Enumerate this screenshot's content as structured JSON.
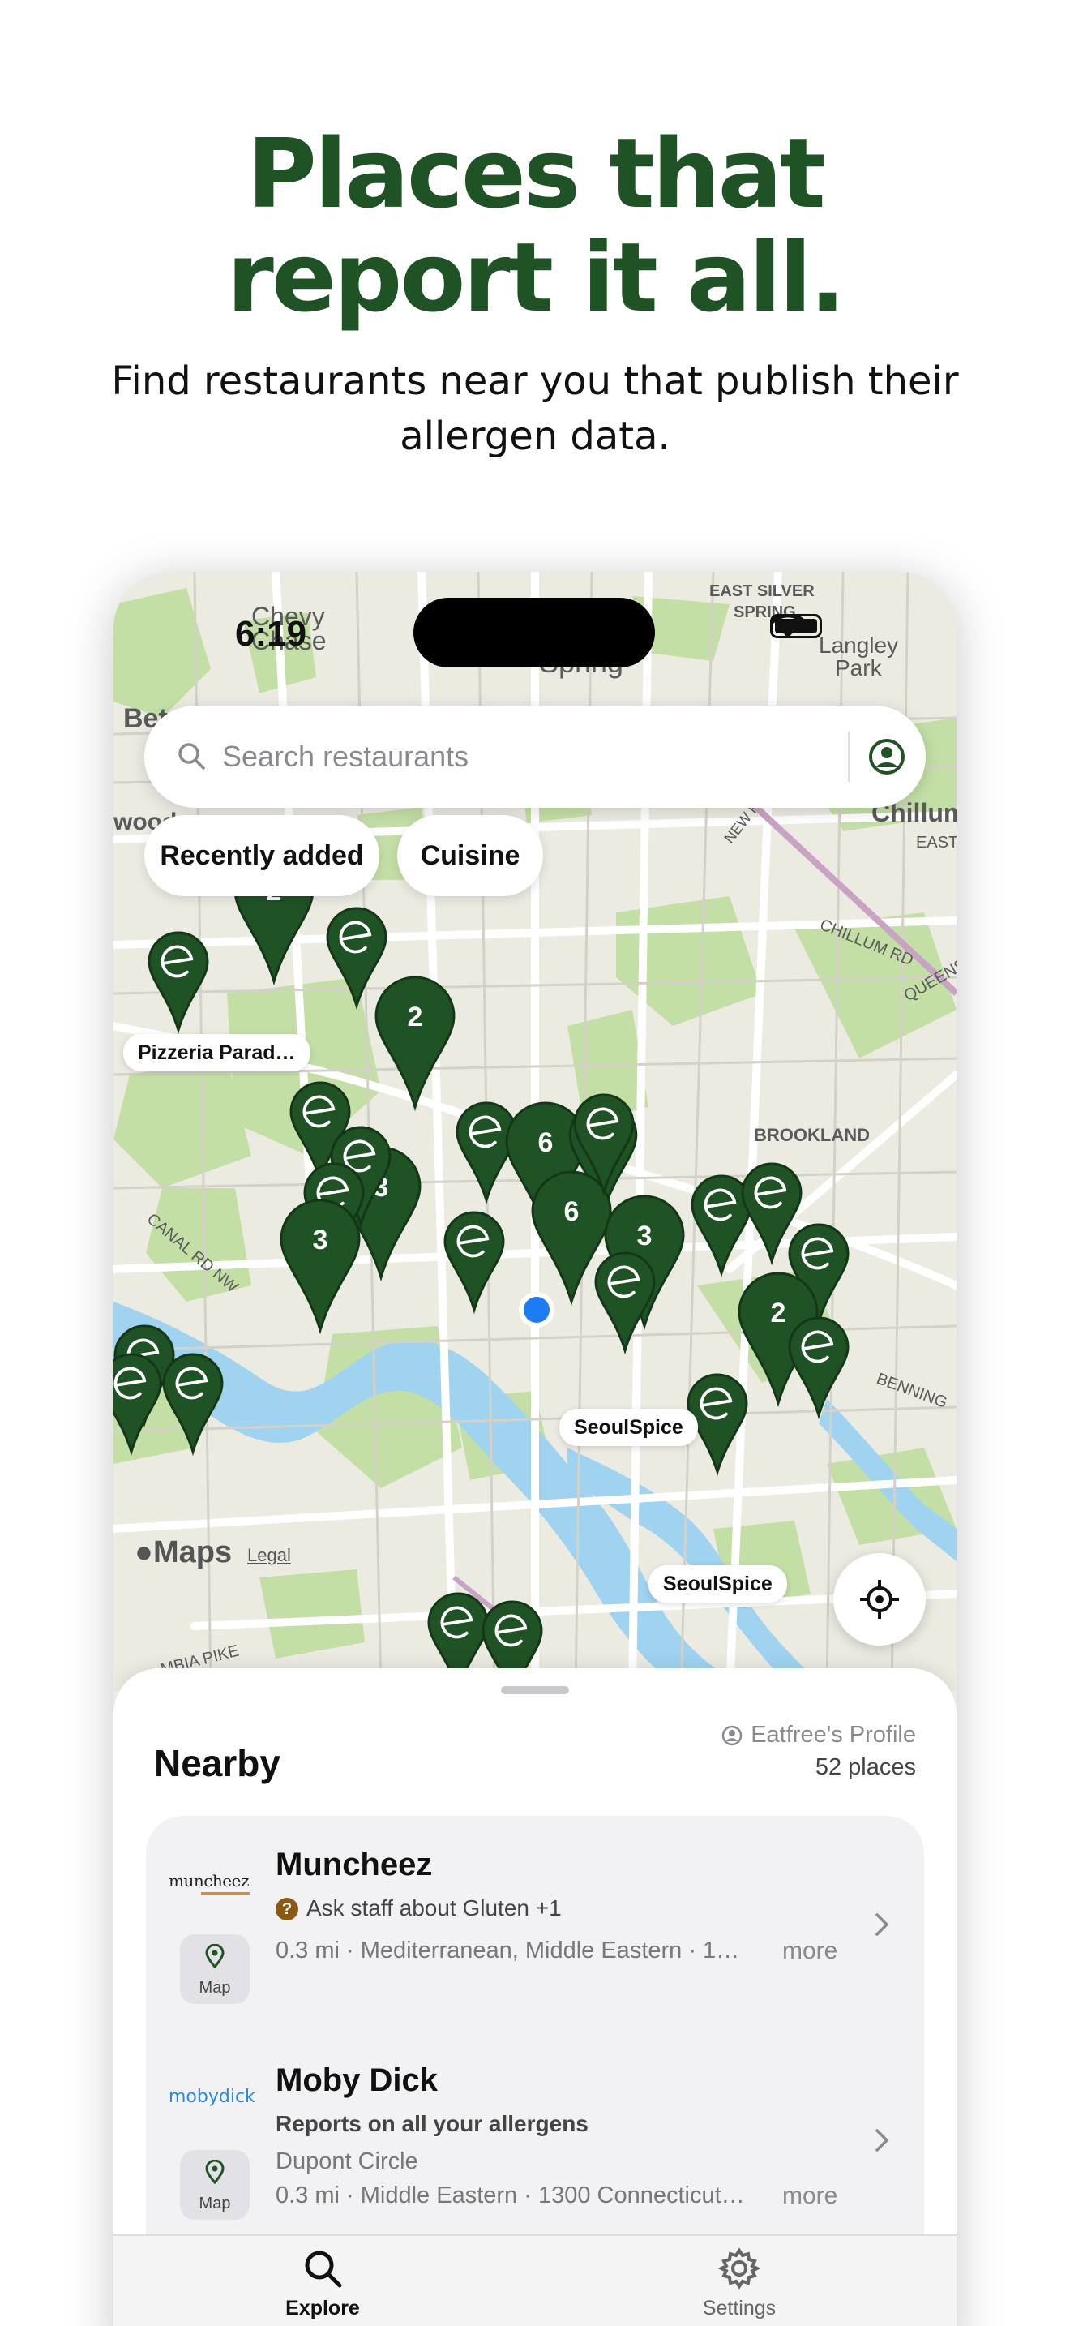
{
  "hero": {
    "headline_line1": "Places that",
    "headline_line2": "report it all.",
    "subhead": "Find restaurants near you that publish their allergen data."
  },
  "status_bar": {
    "time": "6:19"
  },
  "search": {
    "placeholder": "Search restaurants"
  },
  "filters": [
    "Recently added",
    "Cuisine"
  ],
  "map": {
    "place_names": [
      "Chevy Chase",
      "Spring",
      "EAST SILVER SPRING",
      "Langley Park",
      "Chillum",
      "NEW HAMPSHIRE",
      "EAST",
      "CHILLUM RD",
      "QUEENS",
      "BROOKLAND",
      "BENNING",
      "CANAL RD NW",
      "MBIA PIKE",
      "Bet",
      "wood"
    ],
    "pin_labels": [
      "Pizzeria Parad…",
      "SeoulSpice",
      "SeoulSpice"
    ],
    "cluster_counts": [
      "2",
      "2",
      "6",
      "2",
      "3",
      "6",
      "3",
      "3",
      "2"
    ],
    "attribution": "Maps",
    "legal": "Legal",
    "colors": {
      "pin": "#1f5225",
      "land": "#ecebe2",
      "park": "#c4dfa6",
      "water": "#9fd3f0",
      "road": "#ffffff",
      "user_dot": "#1e7cf2"
    }
  },
  "sheet": {
    "title": "Nearby",
    "profile_link": "Eatfree's Profile",
    "place_count": "52 places",
    "map_button_label": "Map",
    "more_label": "more",
    "restaurants": [
      {
        "name": "Muncheez",
        "logo_text": "muncheez",
        "allergen_note": "Ask staff about Gluten +1",
        "details": "0.3 mi · Mediterranean, Middle Eastern · 1…"
      },
      {
        "name": "Moby Dick",
        "logo_text": "mobydick",
        "allergen_note": "Reports on all your allergens",
        "neighborhood": "Dupont Circle",
        "details": "0.3 mi · Middle Eastern · 1300 Connecticut…"
      }
    ]
  },
  "tabs": [
    {
      "label": "Explore",
      "icon": "search-icon",
      "active": true
    },
    {
      "label": "Settings",
      "icon": "gear-icon",
      "active": false
    }
  ]
}
